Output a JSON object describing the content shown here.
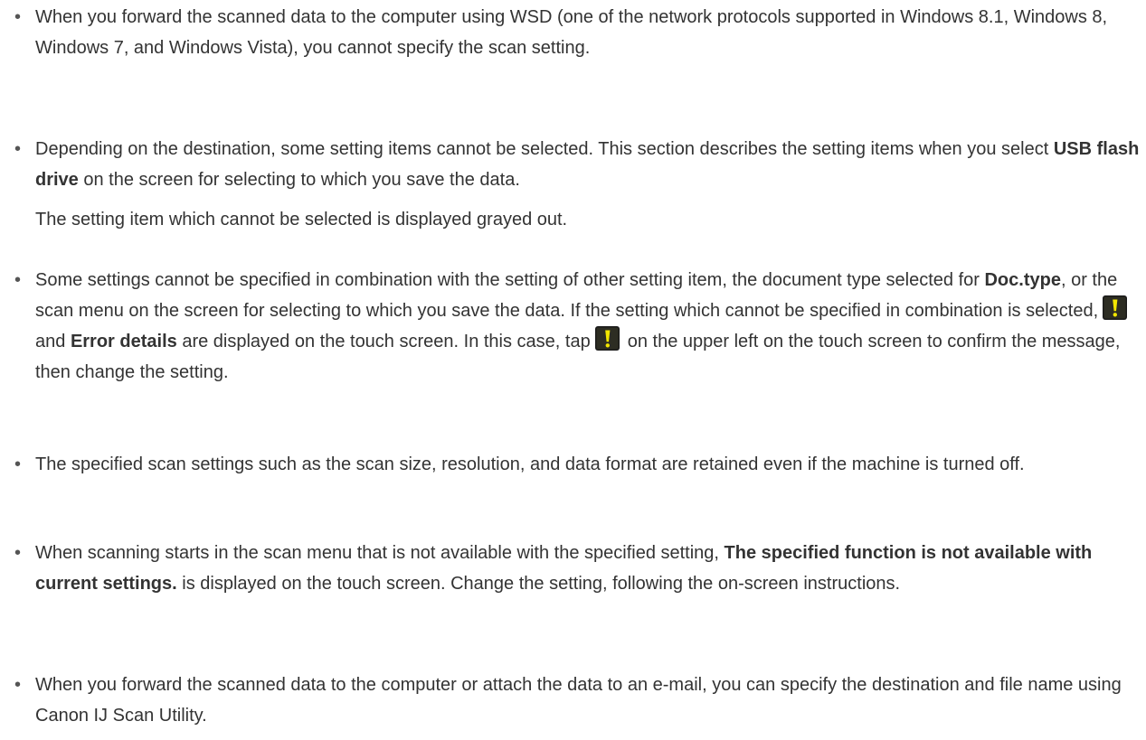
{
  "notes": [
    {
      "bullet": "•",
      "text": "When you forward the scanned data to the computer using WSD (one of the network protocols supported in Windows 8.1, Windows 8, Windows 7, and Windows Vista), you cannot specify the scan setting."
    },
    {
      "bullet": "•",
      "text_a": "Depending on the destination, some setting items cannot be selected. This section describes the setting items when you select ",
      "bold": "USB flash drive",
      "text_b": " on the screen for selecting to which you save the data.",
      "subparagraph": "The setting item which cannot be selected is displayed grayed out."
    },
    {
      "bullet": "•",
      "text_a": "Some settings cannot be specified in combination with the setting of other setting item, the document type selected for ",
      "bold_a": "Doc.type",
      "text_b": ", or the scan menu on the screen for selecting to which you save the data. If the setting which cannot be specified in combination is selected,",
      "text_c": "and ",
      "bold_b": "Error details",
      "text_d": " are displayed on the touch screen. In this case, tap",
      "text_e": "on the upper left on the touch screen to confirm the message, then change the setting."
    },
    {
      "bullet": "•",
      "text": "The specified scan settings such as the scan size, resolution, and data format are retained even if the machine is turned off."
    },
    {
      "bullet": "•",
      "text_a": "When scanning starts in the scan menu that is not available with the specified setting, ",
      "bold": "The specified function is not available with current settings.",
      "text_b": " is displayed on the touch screen. Change the setting, following the on-screen instructions."
    },
    {
      "bullet": "•",
      "text": "When you forward the scanned data to the computer or attach the data to an e-mail, you can specify the destination and file name using Canon IJ Scan Utility."
    }
  ],
  "icons": {
    "warning": "warning-icon",
    "warning_bg": "#1a1a1a",
    "warning_fg": "#f2e600"
  }
}
